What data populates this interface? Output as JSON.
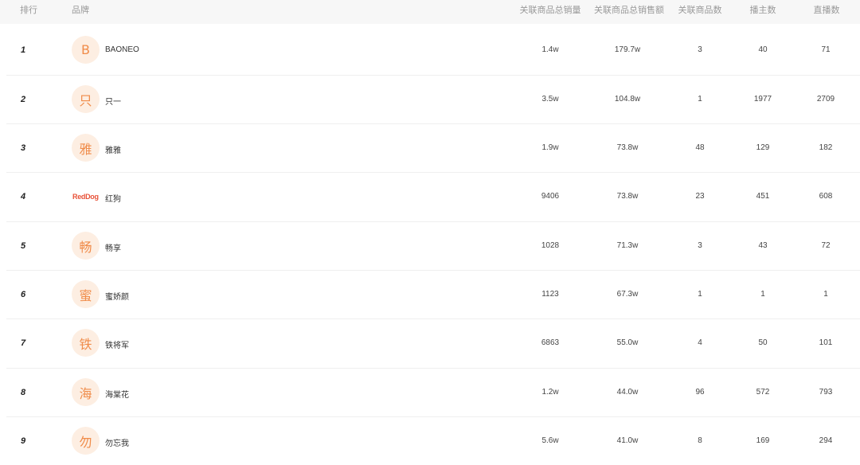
{
  "header": {
    "rank": "排行",
    "brand": "品牌",
    "sales_volume": "关联商品总销量",
    "sales_amount": "关联商品总销售额",
    "product_count": "关联商品数",
    "streamer_count": "播主数",
    "live_count": "直播数"
  },
  "rows": [
    {
      "rank": "1",
      "avatar": "B",
      "name": "BAONEO",
      "volume": "1.4w",
      "amount": "179.7w",
      "products": "3",
      "streamers": "40",
      "lives": "71"
    },
    {
      "rank": "2",
      "avatar": "只",
      "name": "只一",
      "volume": "3.5w",
      "amount": "104.8w",
      "products": "1",
      "streamers": "1977",
      "lives": "2709"
    },
    {
      "rank": "3",
      "avatar": "雅",
      "name": "雅雅",
      "volume": "1.9w",
      "amount": "73.8w",
      "products": "48",
      "streamers": "129",
      "lives": "182"
    },
    {
      "rank": "4",
      "avatar": "RedDog",
      "name": "红狗",
      "volume": "9406",
      "amount": "73.8w",
      "products": "23",
      "streamers": "451",
      "lives": "608"
    },
    {
      "rank": "5",
      "avatar": "畅",
      "name": "畅享",
      "volume": "1028",
      "amount": "71.3w",
      "products": "3",
      "streamers": "43",
      "lives": "72"
    },
    {
      "rank": "6",
      "avatar": "蜜",
      "name": "蜜娇颜",
      "volume": "1123",
      "amount": "67.3w",
      "products": "1",
      "streamers": "1",
      "lives": "1"
    },
    {
      "rank": "7",
      "avatar": "铁",
      "name": "铁将军",
      "volume": "6863",
      "amount": "55.0w",
      "products": "4",
      "streamers": "50",
      "lives": "101"
    },
    {
      "rank": "8",
      "avatar": "海",
      "name": "海棠花",
      "volume": "1.2w",
      "amount": "44.0w",
      "products": "96",
      "streamers": "572",
      "lives": "793"
    },
    {
      "rank": "9",
      "avatar": "勿",
      "name": "勿忘我",
      "volume": "5.6w",
      "amount": "41.0w",
      "products": "8",
      "streamers": "169",
      "lives": "294"
    }
  ]
}
